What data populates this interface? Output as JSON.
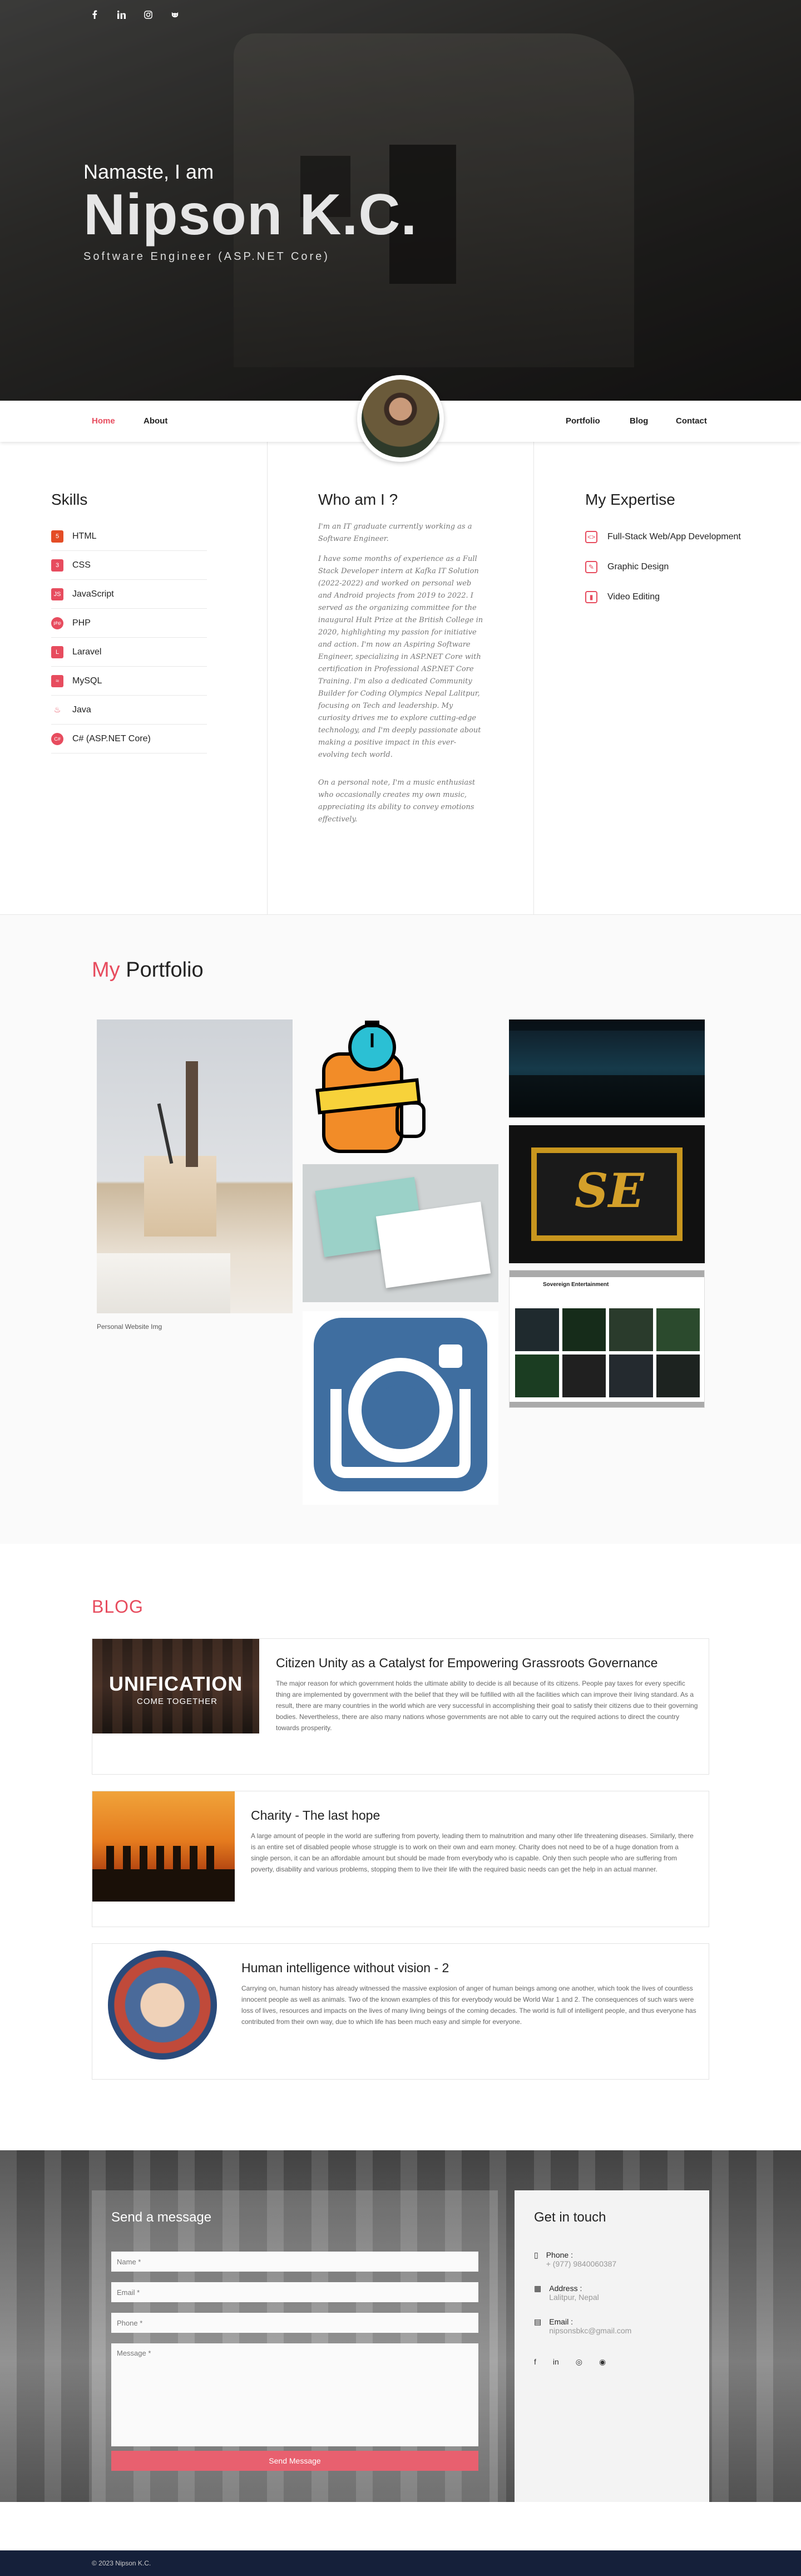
{
  "social": [
    "facebook",
    "linkedin",
    "instagram",
    "github"
  ],
  "hero": {
    "greeting": "Namaste, I am",
    "name": "Nipson K.C.",
    "role": "Software Engineer (ASP.NET Core)"
  },
  "nav": {
    "left": [
      "Home",
      "About"
    ],
    "right": [
      "Portfolio",
      "Blog",
      "Contact"
    ],
    "active": "Home"
  },
  "skills": {
    "title": "Skills",
    "items": [
      "HTML",
      "CSS",
      "JavaScript",
      "PHP",
      "Laravel",
      "MySQL",
      "Java",
      "C# (ASP.NET Core)"
    ]
  },
  "who": {
    "title": "Who am I ?",
    "p1": "I'm an IT graduate currently working as a Software Engineer.",
    "p2": "I have some months of experience as a Full Stack Developer intern at Kafka IT Solution (2022-2022) and worked on personal web and Android projects from 2019 to 2022. I served as the organizing committee for the inaugural Hult Prize at the British College in 2020, highlighting my passion for initiative and action. I'm now an Aspiring Software Engineer, specializing in ASP.NET Core with certification in Professional ASP.NET Core Training. I'm also a dedicated Community Builder for Coding Olympics Nepal Lalitpur, focusing on Tech and leadership. My curiosity drives me to explore cutting-edge technology, and I'm deeply passionate about making a positive impact in this ever-evolving tech world.",
    "p3": "On a personal note, I'm a music enthusiast who occasionally creates my own music, appreciating its ability to convey emotions effectively."
  },
  "expertise": {
    "title": "My Expertise",
    "items": [
      "Full-Stack Web/App Development",
      "Graphic Design",
      "Video Editing"
    ]
  },
  "portfolio": {
    "title_my": "My",
    "title_rest": "Portfolio",
    "broken_img": "Personal Website Img",
    "pf_site_label": "Sovereign Entertainment"
  },
  "blog": {
    "title": "BLOG",
    "posts": [
      {
        "title": "Citizen Unity as a Catalyst for Empowering Grassroots Governance",
        "image_text": "UNIFICATION",
        "image_sub": "COME TOGETHER",
        "body": "The major reason for which government holds the ultimate ability to decide is all because of its citizens. People pay taxes for every specific thing are implemented by government with the belief that they will be fulfilled with all the facilities which can improve their living standard. As a result, there are many countries in the world which are very successful in accomplishing their goal to satisfy their citizens due to their governing bodies. Nevertheless, there are also many nations whose governments are not able to carry out the required actions to direct the country towards prosperity."
      },
      {
        "title": "Charity - The last hope",
        "body": "A large amount of people in the world are suffering from poverty, leading them to malnutrition and many other life threatening diseases. Similarly, there is an entire set of disabled people whose struggle is to work on their own and earn money. Charity does not need to be of a huge donation from a single person, it can be an affordable amount but should be made from everybody who is capable. Only then such people who are suffering from poverty, disability and various problems, stopping them to live their life with the required basic needs can get the help in an actual manner."
      },
      {
        "title": "Human intelligence without vision - 2",
        "body": "Carrying on, human history has already witnessed the massive explosion of anger of human beings among one another, which took the lives of countless innocent people as well as animals. Two of the known examples of this for everybody would be World War 1 and 2. The consequences of such wars were loss of lives, resources and impacts on the lives of many living beings of the coming decades. The world is full of intelligent people, and thus everyone has contributed from their own way, due to which life has been much easy and simple for everyone."
      }
    ]
  },
  "contact": {
    "form_title": "Send a message",
    "fields": {
      "name": "Name *",
      "email": "Email *",
      "phone": "Phone *",
      "message": "Message *"
    },
    "send": "Send Message",
    "info_title": "Get in touch",
    "phone_label": "Phone :",
    "phone": "+ (977) 9840060387",
    "address_label": "Address :",
    "address": "Lalitpur, Nepal",
    "email_label": "Email :",
    "email": "nipsonsbkc@gmail.com"
  },
  "footer": "© 2023 Nipson K.C."
}
